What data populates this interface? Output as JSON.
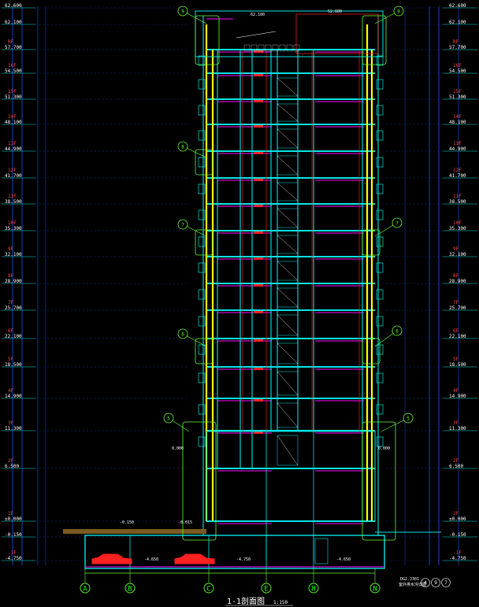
{
  "drawing": {
    "title": "1-1剖面图",
    "scale": "1:150",
    "colors": {
      "background": "#000000",
      "structure": "#00e5e5",
      "column": "#ffff00",
      "accent": "#ff00ff",
      "red": "#ff2020",
      "callout": "#66ff33",
      "dim": "#1a66ff",
      "white": "#ffffff"
    }
  },
  "levels": [
    {
      "floor": "",
      "elev": "62.600"
    },
    {
      "floor": "",
      "elev": "62.100"
    },
    {
      "floor": "RF",
      "elev": "57.700"
    },
    {
      "floor": "16F",
      "elev": "54.500"
    },
    {
      "floor": "15F",
      "elev": "51.300"
    },
    {
      "floor": "14F",
      "elev": "48.100"
    },
    {
      "floor": "13F",
      "elev": "44.900"
    },
    {
      "floor": "12F",
      "elev": "41.700"
    },
    {
      "floor": "11F",
      "elev": "38.500"
    },
    {
      "floor": "10F",
      "elev": "35.300"
    },
    {
      "floor": "9F",
      "elev": "32.100"
    },
    {
      "floor": "8F",
      "elev": "28.900"
    },
    {
      "floor": "7F",
      "elev": "25.700"
    },
    {
      "floor": "6F",
      "elev": "22.100"
    },
    {
      "floor": "5F",
      "elev": "18.500"
    },
    {
      "floor": "4F",
      "elev": "14.900"
    },
    {
      "floor": "3F",
      "elev": "11.300"
    },
    {
      "floor": "2F",
      "elev": "6.500"
    },
    {
      "floor": "1F",
      "elev": "±0.000"
    },
    {
      "floor": "",
      "elev": "-0.150"
    },
    {
      "floor": "-1F",
      "elev": "-4.750"
    }
  ],
  "axes": [
    "A",
    "B",
    "C",
    "E",
    "H",
    "N"
  ],
  "callouts": [
    "5",
    "6",
    "7",
    "8",
    "9"
  ],
  "annotations": {
    "ground_left": "-0.150",
    "ground_mid": "-0.015",
    "inner_zero": "0.000",
    "basement_a": "-4.650",
    "basement_b": "-4.750",
    "basement_c": "-4.650",
    "top_a": "62.100",
    "top_b": "52.600",
    "detail_ref": "DG2.J301",
    "detail_note": "室外排水沟详图"
  }
}
